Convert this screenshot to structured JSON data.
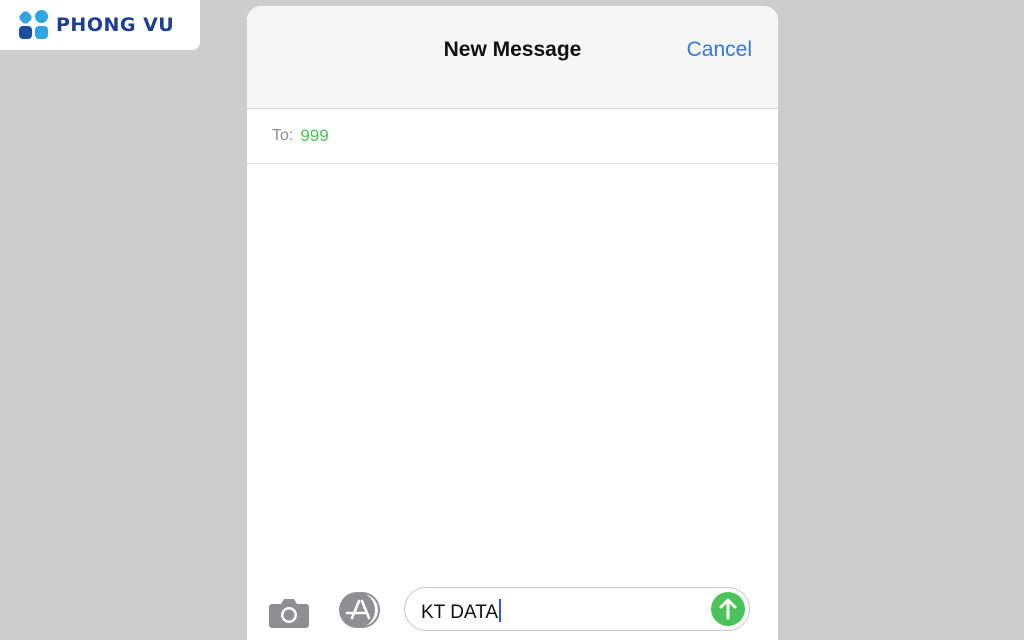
{
  "watermark": {
    "text": "PHONG VU",
    "colors": {
      "primary": "#1d3f8f",
      "accent": "#2fa6e0"
    }
  },
  "navbar": {
    "title": "New Message",
    "cancel_label": "Cancel"
  },
  "recipient": {
    "label": "To:",
    "value": "999"
  },
  "compose": {
    "message_text": "KT DATA",
    "camera_icon": "camera-icon",
    "appstore_icon": "app-store-icon",
    "send_icon": "arrow-up-icon"
  },
  "colors": {
    "link": "#3478d8",
    "recipient": "#4cc35a",
    "send_button": "#4cc35a",
    "caret": "#2e5bd6"
  }
}
